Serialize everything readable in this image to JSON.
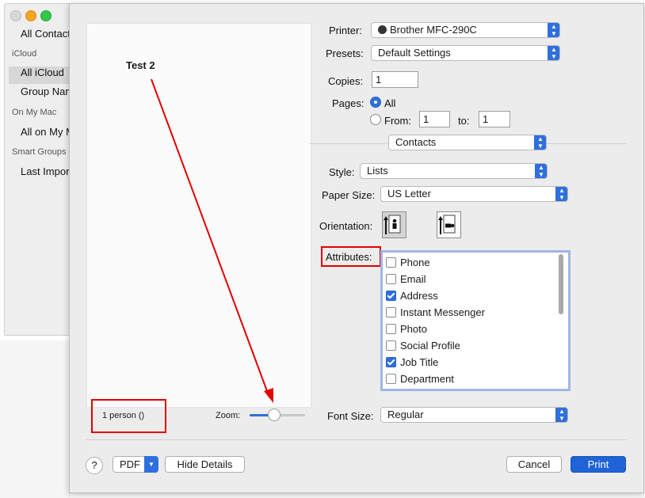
{
  "sidebar": {
    "items": [
      {
        "label": "All Contacts",
        "type": "item"
      },
      {
        "label": "iCloud",
        "type": "header"
      },
      {
        "label": "All iCloud",
        "type": "item"
      },
      {
        "label": "Group Name",
        "type": "item"
      },
      {
        "label": "On My Mac",
        "type": "header"
      },
      {
        "label": "All on My Mac",
        "type": "item"
      },
      {
        "label": "Smart Groups",
        "type": "header"
      },
      {
        "label": "Last Import",
        "type": "item"
      }
    ]
  },
  "preview": {
    "title": "Test 2",
    "count": "1 person ()"
  },
  "zoom": {
    "label": "Zoom:",
    "value": 0.43
  },
  "printer": {
    "label": "Printer:",
    "value": "Brother MFC-290C"
  },
  "presets": {
    "label": "Presets:",
    "value": "Default Settings"
  },
  "copies": {
    "label": "Copies:",
    "value": "1"
  },
  "pages": {
    "label": "Pages:",
    "all_label": "All",
    "from_label": "From:",
    "from_value": "1",
    "to_label": "to:",
    "to_value": "1"
  },
  "section": {
    "value": "Contacts"
  },
  "style": {
    "label": "Style:",
    "value": "Lists"
  },
  "paper_size": {
    "label": "Paper Size:",
    "value": "US Letter"
  },
  "orientation": {
    "label": "Orientation:"
  },
  "attributes": {
    "label": "Attributes:",
    "items": [
      {
        "label": "Phone",
        "checked": false
      },
      {
        "label": "Email",
        "checked": false
      },
      {
        "label": "Address",
        "checked": true
      },
      {
        "label": "Instant Messenger",
        "checked": false
      },
      {
        "label": "Photo",
        "checked": false
      },
      {
        "label": "Social Profile",
        "checked": false
      },
      {
        "label": "Job Title",
        "checked": true
      },
      {
        "label": "Department",
        "checked": false
      }
    ]
  },
  "font_size": {
    "label": "Font Size:",
    "value": "Regular"
  },
  "footer": {
    "help_label": "?",
    "pdf_label": "PDF",
    "hide_details_label": "Hide Details",
    "cancel_label": "Cancel",
    "print_label": "Print"
  },
  "colors": {
    "accent": "#2f6fdd",
    "annotation": "#e50000"
  }
}
